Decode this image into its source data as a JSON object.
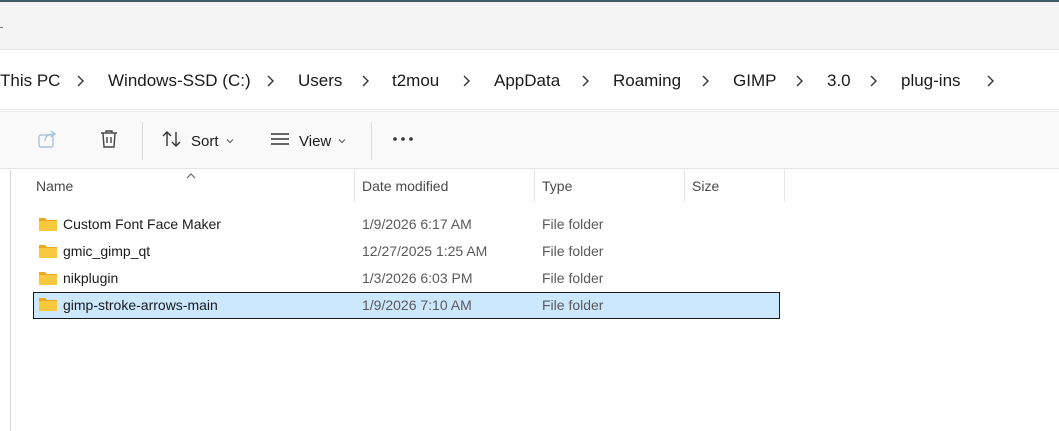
{
  "breadcrumb": [
    "This PC",
    "Windows-SSD (C:)",
    "Users",
    "t2mou",
    "AppData",
    "Roaming",
    "GIMP",
    "3.0",
    "plug-ins"
  ],
  "toolbar": {
    "share_icon": "share-icon",
    "delete_icon": "trash-icon",
    "sort_label": "Sort",
    "view_label": "View",
    "more_label": "···"
  },
  "columns": {
    "name": "Name",
    "date": "Date modified",
    "type": "Type",
    "size": "Size"
  },
  "files": [
    {
      "name": "Custom Font Face Maker",
      "date": "1/9/2026 6:17 AM",
      "type": "File folder",
      "selected": false
    },
    {
      "name": "gmic_gimp_qt",
      "date": "12/27/2025 1:25 AM",
      "type": "File folder",
      "selected": false
    },
    {
      "name": "nikplugin",
      "date": "1/3/2026 6:03 PM",
      "type": "File folder",
      "selected": false
    },
    {
      "name": "gimp-stroke-arrows-main",
      "date": "1/9/2026 7:10 AM",
      "type": "File folder",
      "selected": true
    }
  ],
  "colors": {
    "selection_bg": "#cce8ff",
    "folder_yellow": "#f8c93f"
  }
}
